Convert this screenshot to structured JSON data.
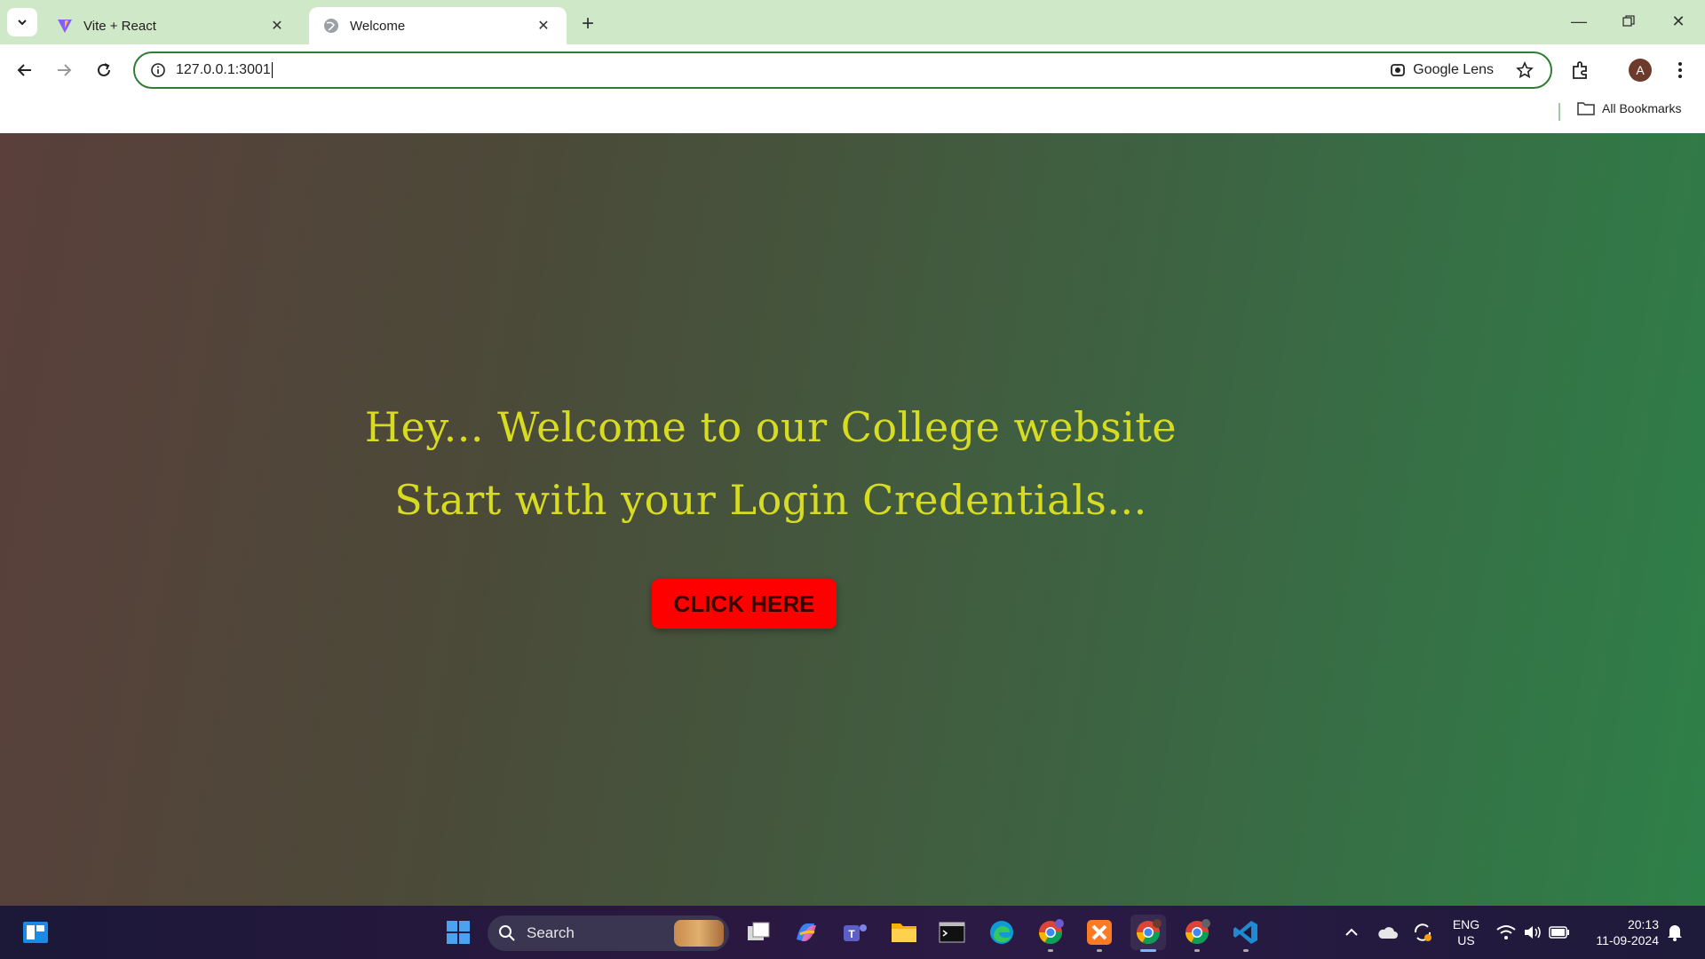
{
  "browser": {
    "tabs": [
      {
        "title": "Vite + React",
        "active": false
      },
      {
        "title": "Welcome",
        "active": true
      }
    ],
    "address_bar": {
      "url": "127.0.0.1:3001"
    },
    "lens_label": "Google Lens",
    "profile_initial": "A",
    "bookmarks_label": "All Bookmarks"
  },
  "page": {
    "heading_line1": "Hey... Welcome to our College website",
    "heading_line2": "Start with your Login Credentials...",
    "button_label": "CLICK HERE",
    "heading_color": "#d7dc21",
    "button_color": "#ff0000"
  },
  "taskbar": {
    "search_label": "Search",
    "language": "ENG",
    "region": "US",
    "time": "20:13",
    "date": "11-09-2024",
    "apps": [
      "start-icon",
      "search-icon",
      "task-view-icon",
      "copilot-icon",
      "teams-icon",
      "file-explorer-icon",
      "terminal-icon",
      "edge-icon",
      "chrome-profile-j-icon",
      "xampp-icon",
      "chrome-profile-a-icon",
      "chrome-profile-i-icon",
      "vscode-icon"
    ]
  }
}
